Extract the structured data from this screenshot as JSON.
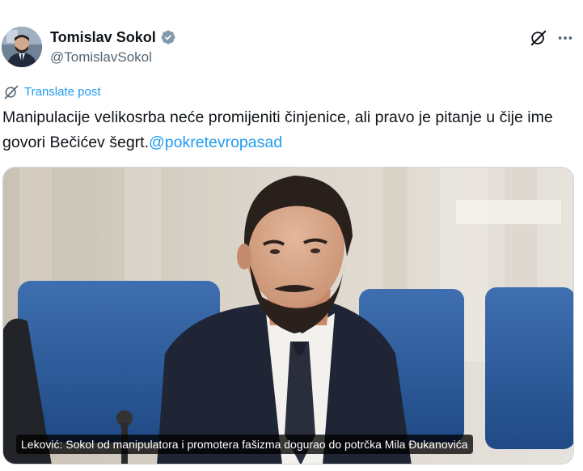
{
  "author": {
    "name": "Tomislav Sokol",
    "handle": "@TomislavSokol",
    "verified": true
  },
  "header_icons": {
    "grok": "grok-icon",
    "more": "more-options-icon"
  },
  "translate": {
    "label": "Translate post",
    "icon": "grok-translate-icon"
  },
  "post": {
    "text": "Manipulacije velikosrba neće promijeniti činjenice, ali pravo je pitanje u čije ime govori Bečićev šegrt.",
    "mention": "@pokretevropasad"
  },
  "card": {
    "caption": "Leković: Sokol od manipulatora i promotera fašizma dogurao do potrčka Mila Đukanovića"
  },
  "colors": {
    "accent": "#1d9bf0",
    "text": "#0f1419",
    "secondary": "#536471",
    "verified": "#829aab"
  }
}
